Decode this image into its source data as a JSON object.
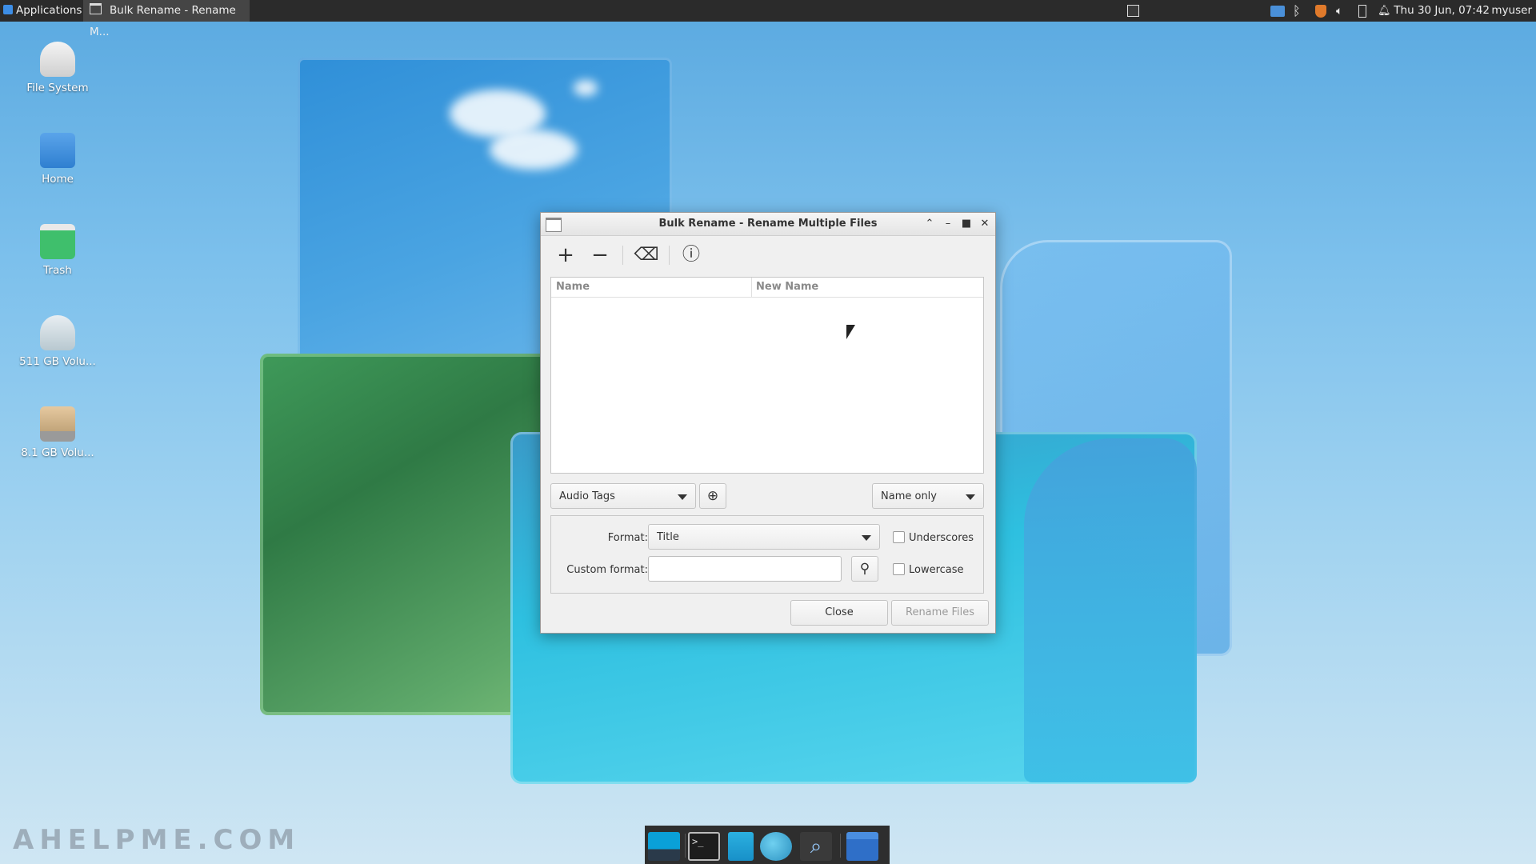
{
  "panel": {
    "applications_label": "Applications",
    "task_title": "Bulk Rename - Rename M...",
    "clock": "Thu 30 Jun, 07:42",
    "user": "myuser"
  },
  "desktop": {
    "icons": [
      {
        "label": "File System",
        "icon": "drive-icon"
      },
      {
        "label": "Home",
        "icon": "home-folder-icon"
      },
      {
        "label": "Trash",
        "icon": "trash-icon"
      },
      {
        "label": "511 GB Volu...",
        "icon": "volume-icon"
      },
      {
        "label": "8.1 GB Volu...",
        "icon": "volume-icon"
      }
    ],
    "watermark": "AHELPME.COM"
  },
  "dialog": {
    "title": "Bulk Rename - Rename Multiple Files",
    "toolbar": {
      "add_icon": "plus-icon",
      "remove_icon": "minus-icon",
      "clear_icon": "clear-icon",
      "about_icon": "info-icon"
    },
    "columns": [
      "Name",
      "New Name"
    ],
    "renamer_combo": "Audio Tags",
    "scope_combo": "Name only",
    "format_label": "Format:",
    "format_value": "Title",
    "custom_format_label": "Custom format:",
    "custom_format_value": "",
    "underscores_label": "Underscores",
    "underscores_checked": false,
    "lowercase_label": "Lowercase",
    "lowercase_checked": false,
    "close_button": "Close",
    "rename_button": "Rename Files",
    "rename_enabled": false
  },
  "dock": {
    "items": [
      "show-desktop-icon",
      "terminal-icon",
      "file-manager-icon",
      "web-browser-icon",
      "search-icon",
      "folder-icon"
    ]
  }
}
